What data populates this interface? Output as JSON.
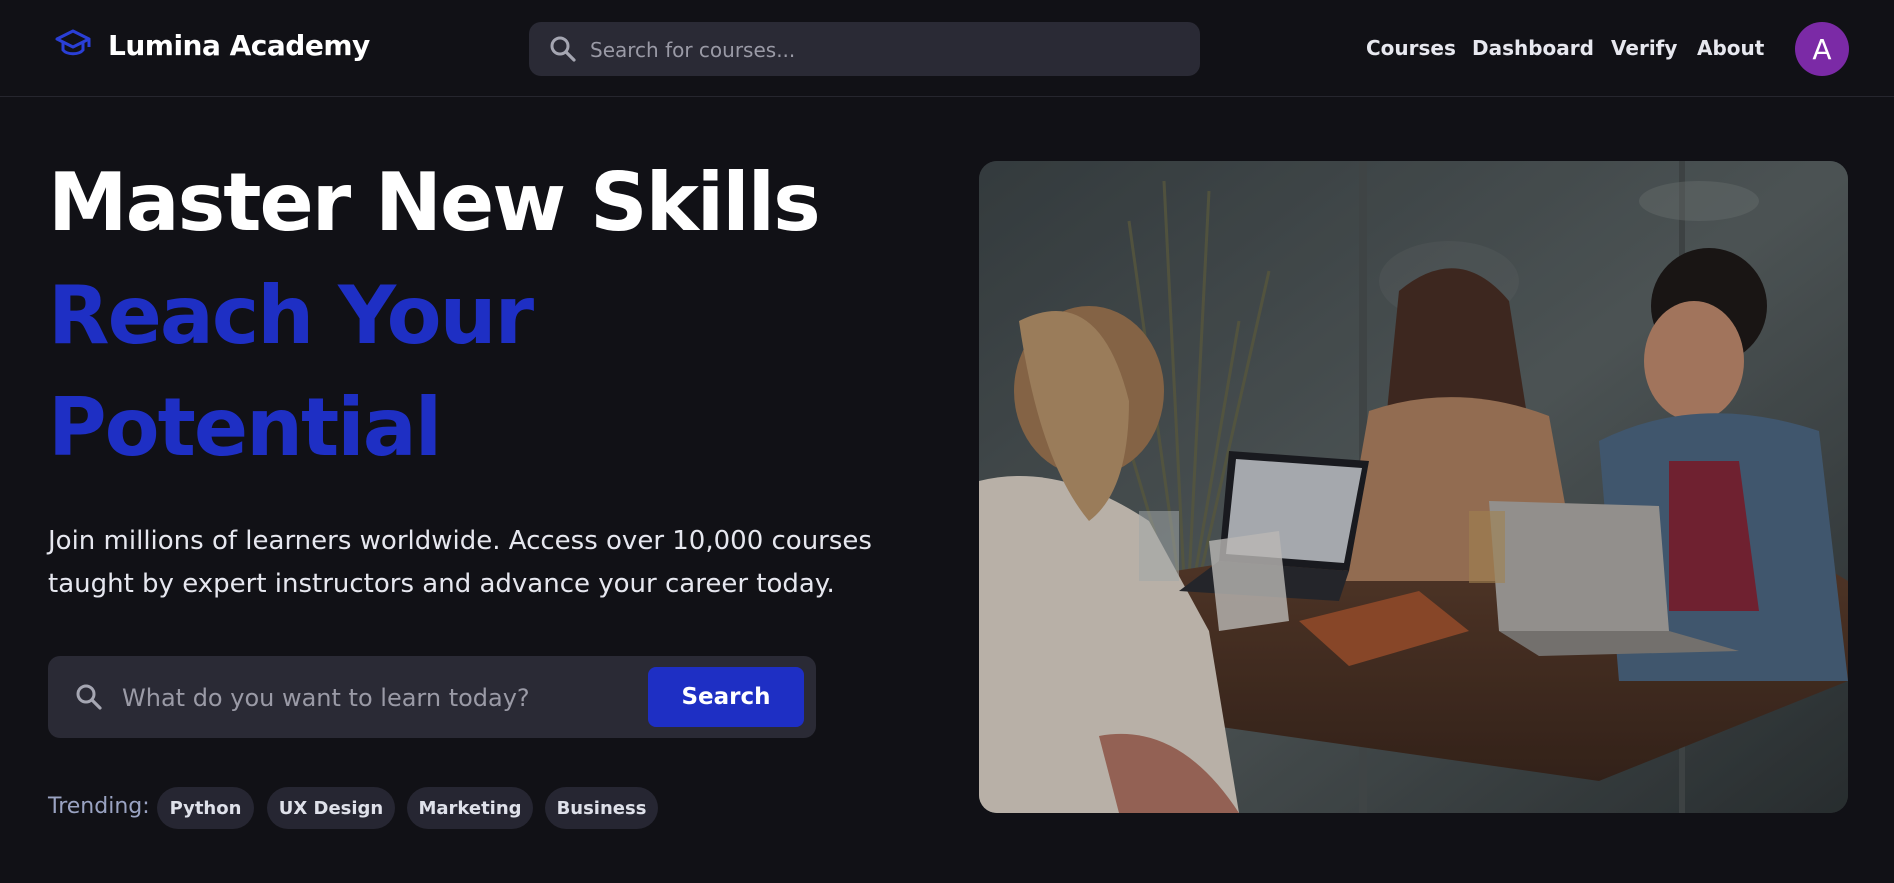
{
  "header": {
    "brand": "Lumina Academy",
    "search_placeholder": "Search for courses...",
    "nav": [
      "Courses",
      "Dashboard",
      "Verify",
      "About"
    ],
    "avatar_initial": "A"
  },
  "hero": {
    "title_line1": "Master New Skills",
    "title_line2": "Reach Your",
    "title_line3": "Potential",
    "description": "Join millions of learners worldwide. Access over 10,000 courses taught by expert instructors and advance your career today.",
    "search_placeholder": "What do you want to learn today?",
    "search_button": "Search",
    "trending_label": "Trending:",
    "trending": [
      "Python",
      "UX Design",
      "Marketing",
      "Business"
    ]
  },
  "colors": {
    "background": "#111116",
    "accent_blue": "#1e2fc4",
    "input_bg": "#2a2a35",
    "avatar": "#7b2aa6"
  },
  "icons": {
    "brand": "graduation-cap-icon",
    "search": "search-icon"
  }
}
